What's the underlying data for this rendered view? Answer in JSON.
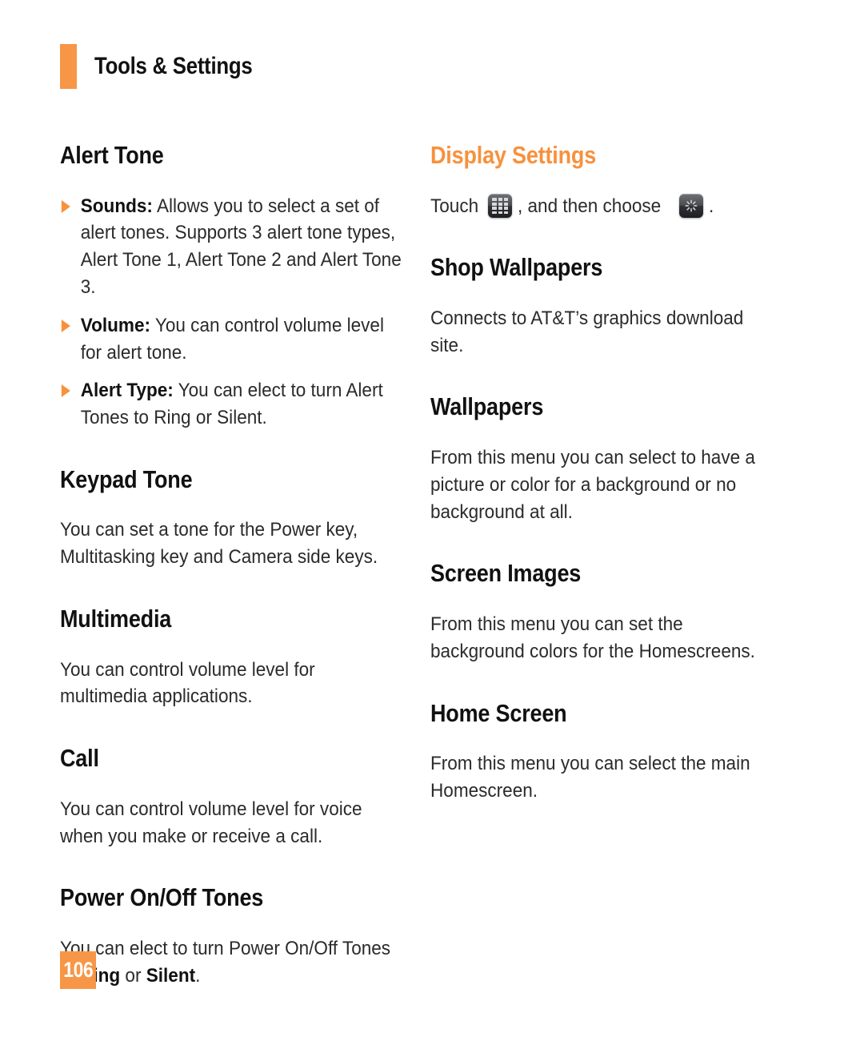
{
  "page": {
    "running_head": "Tools & Settings",
    "page_number": "106",
    "accent_color": "#F79646",
    "heading_orange": "#F7913D"
  },
  "left_column": {
    "alert_tone": {
      "heading": "Alert Tone",
      "bullets": [
        {
          "marker": "triangle-bullet-icon",
          "term": "Sounds:",
          "text": " Allows you to select a set of alert tones. Supports 3 alert tone types, Alert Tone 1, Alert Tone 2 and Alert Tone 3."
        },
        {
          "marker": "triangle-bullet-icon",
          "term": "Volume:",
          "text": " You can control volume level for alert tone."
        },
        {
          "marker": "triangle-bullet-icon",
          "term": "Alert Type:",
          "text": " You can elect to turn Alert Tones to Ring or Silent."
        }
      ]
    },
    "keypad_tone": {
      "heading": "Keypad Tone",
      "body": "You can set a tone for the Power key, Multitasking key and Camera side keys."
    },
    "multimedia": {
      "heading": "Multimedia",
      "body": "You can control volume level for multimedia applications."
    },
    "call": {
      "heading": "Call",
      "body": "You can control volume level for voice when you make or receive a call."
    },
    "power_tones": {
      "heading": "Power On/Off Tones",
      "body_before": "You can elect to turn Power On/Off Tones to ",
      "bold_one": "Ring",
      "body_middle": " or ",
      "bold_two": "Silent",
      "body_after": "."
    }
  },
  "right_column": {
    "display_settings": {
      "heading": "Display Settings",
      "touch_prefix": "Touch",
      "icon_one": "app-grid-icon",
      "touch_middle": ", and then choose",
      "icon_two": "display-brightness-icon",
      "touch_suffix": "."
    },
    "shop_wallpapers": {
      "heading": "Shop Wallpapers",
      "body": "Connects to AT&T’s graphics download site."
    },
    "wallpapers": {
      "heading": "Wallpapers",
      "body": "From this menu you can select to have a picture or color for a background or no background at all."
    },
    "screen_images": {
      "heading": "Screen Images",
      "body": "From this menu you can set the background colors for the Homescreens."
    },
    "home_screen": {
      "heading": "Home Screen",
      "body": "From this menu you can select the main Homescreen."
    }
  }
}
